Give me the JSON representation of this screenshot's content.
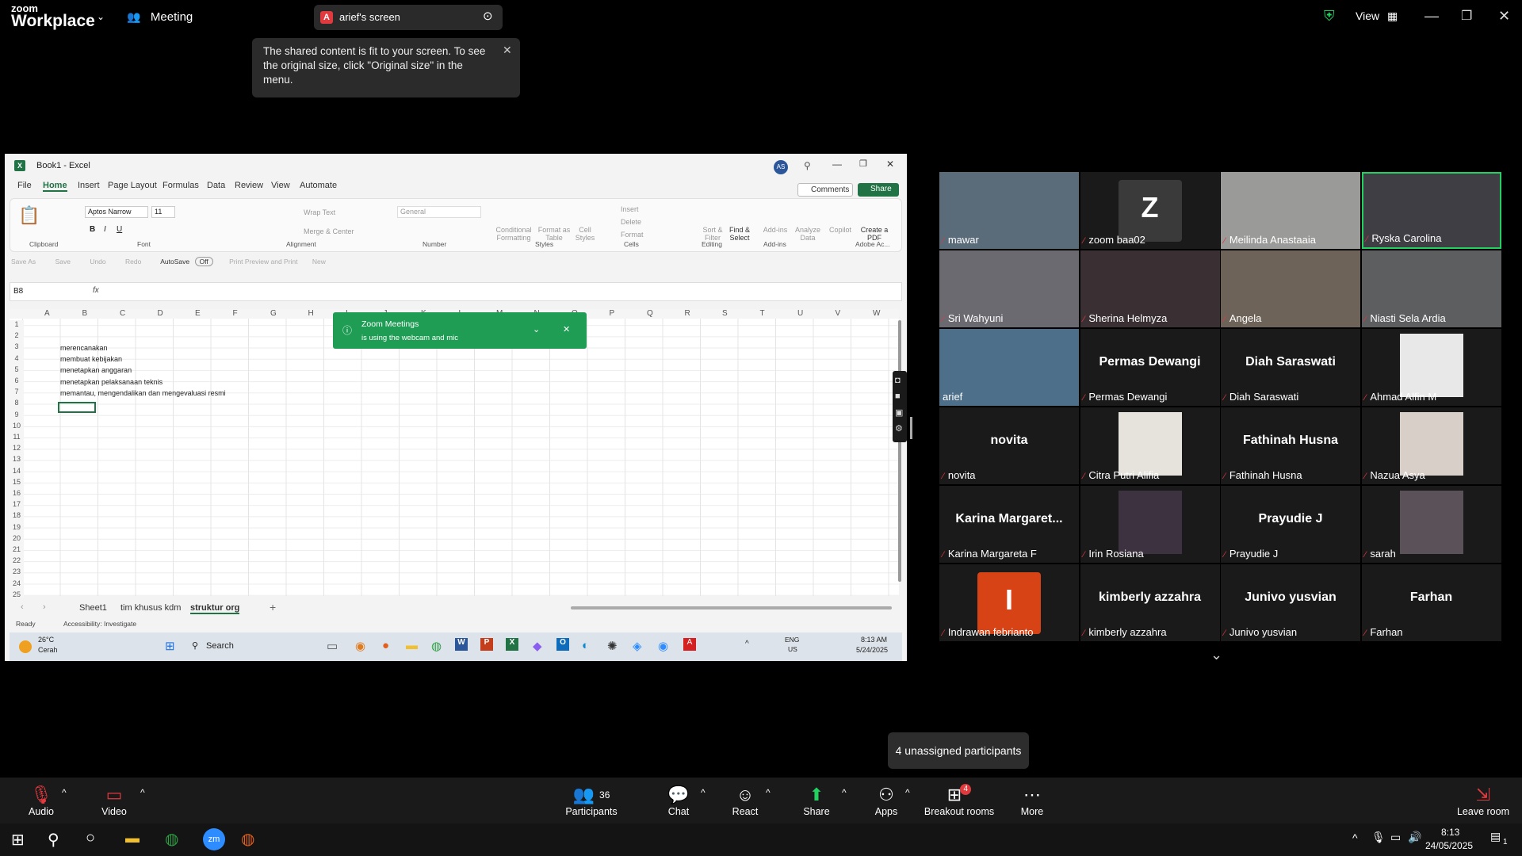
{
  "zoom": {
    "brand_top": "zoom",
    "brand_bottom": "Workplace",
    "meeting_label": "Meeting",
    "share_badge": "A",
    "share_title": "arief's screen",
    "view_label": "View",
    "tooltip": "The shared content is fit to your screen. To see the original size, click \"Original size\" in the menu.",
    "unassigned": "4 unassigned participants"
  },
  "excel": {
    "title": "Book1 - Excel",
    "avatar": "AS",
    "comments_label": "Comments",
    "share_label": "Share",
    "tabs": [
      "File",
      "Home",
      "Insert",
      "Page Layout",
      "Formulas",
      "Data",
      "Review",
      "View",
      "Automate"
    ],
    "font_name": "Aptos Narrow",
    "font_size": "11",
    "number_format": "General",
    "groups": [
      "Clipboard",
      "Font",
      "Alignment",
      "Number",
      "Styles",
      "Cells",
      "Editing",
      "Add-ins",
      "Adobe Ac..."
    ],
    "ribbon_items": [
      "Wrap Text",
      "Merge & Center",
      "Conditional Formatting",
      "Format as Table",
      "Cell Styles",
      "Insert",
      "Delete",
      "Format",
      "Sort & Filter",
      "Find & Select",
      "Add-ins",
      "Analyze Data",
      "Copilot",
      "Create a PDF"
    ],
    "qat": [
      "Save As",
      "Save",
      "Undo",
      "Redo",
      "AutoSave",
      "Off",
      "Print Preview and Print",
      "New"
    ],
    "name_box": "B8",
    "fx": "fx",
    "columns": [
      "A",
      "B",
      "C",
      "D",
      "E",
      "F",
      "G",
      "H",
      "I",
      "J",
      "K",
      "L",
      "M",
      "N",
      "O",
      "P",
      "Q",
      "R",
      "S",
      "T",
      "U",
      "V",
      "W"
    ],
    "rows": [
      "1",
      "2",
      "3",
      "4",
      "5",
      "6",
      "7",
      "8",
      "9",
      "10",
      "11",
      "12",
      "13",
      "14",
      "15",
      "16",
      "17",
      "18",
      "19",
      "20",
      "21",
      "22",
      "23",
      "24",
      "25"
    ],
    "cells": [
      "merencanakan",
      "membuat kebijakan",
      "menetapkan anggaran",
      "menetapkan pelaksanaan teknis",
      "memantau, mengendalikan dan mengevaluasi resmi"
    ],
    "sheets": [
      "Sheet1",
      "tim khusus kdm",
      "struktur org"
    ],
    "status_ready": "Ready",
    "status_access": "Accessibility: Investigate",
    "notif_title": "Zoom Meetings",
    "notif_sub": "is using the webcam and mic"
  },
  "inner_taskbar": {
    "weather_temp": "26°C",
    "weather_desc": "Cerah",
    "search": "Search",
    "lang1": "ENG",
    "lang2": "US",
    "time": "8:13 AM",
    "date": "5/24/2025"
  },
  "participants": [
    {
      "name": "mawar"
    },
    {
      "name": "zoom baa02",
      "initial": "Z"
    },
    {
      "name": "Meilinda Anastaaia"
    },
    {
      "name": "Ryska Carolina"
    },
    {
      "name": "Sri Wahyuni"
    },
    {
      "name": "Sherina Helmyza"
    },
    {
      "name": "Angela"
    },
    {
      "name": "Niasti Sela Ardia"
    },
    {
      "name": "arief"
    },
    {
      "name": "Permas Dewangi",
      "big": "Permas Dewangi"
    },
    {
      "name": "Diah Saraswati",
      "big": "Diah Saraswati"
    },
    {
      "name": "Ahmad Alfin M"
    },
    {
      "name": "novita",
      "big": "novita"
    },
    {
      "name": "Citra Putri Alifia"
    },
    {
      "name": "Fathinah Husna",
      "big": "Fathinah Husna"
    },
    {
      "name": "Nazua Asya"
    },
    {
      "name": "Karina Margareta F",
      "big": "Karina  Margaret..."
    },
    {
      "name": "Irin Rosiana"
    },
    {
      "name": "Prayudie J",
      "big": "Prayudie J"
    },
    {
      "name": "sarah"
    },
    {
      "name": "Indrawan febrianto",
      "initial": "I"
    },
    {
      "name": "kimberly azzahra",
      "big": "kimberly azzahra"
    },
    {
      "name": "Junivo yusvian",
      "big": "Junivo yusvian"
    },
    {
      "name": "Farhan",
      "big": "Farhan"
    }
  ],
  "toolbar": {
    "audio": "Audio",
    "video": "Video",
    "participants": "Participants",
    "participants_count": "36",
    "chat": "Chat",
    "react": "React",
    "share": "Share",
    "apps": "Apps",
    "breakout": "Breakout rooms",
    "breakout_badge": "4",
    "more": "More",
    "leave": "Leave room"
  },
  "windows": {
    "time": "8:13",
    "date": "24/05/2025",
    "notif_count": "1"
  },
  "colors": {
    "zoom_green": "#1f9d55",
    "active_speaker": "#23d160",
    "excel_green": "#217346",
    "mute_red": "#e0393e"
  }
}
